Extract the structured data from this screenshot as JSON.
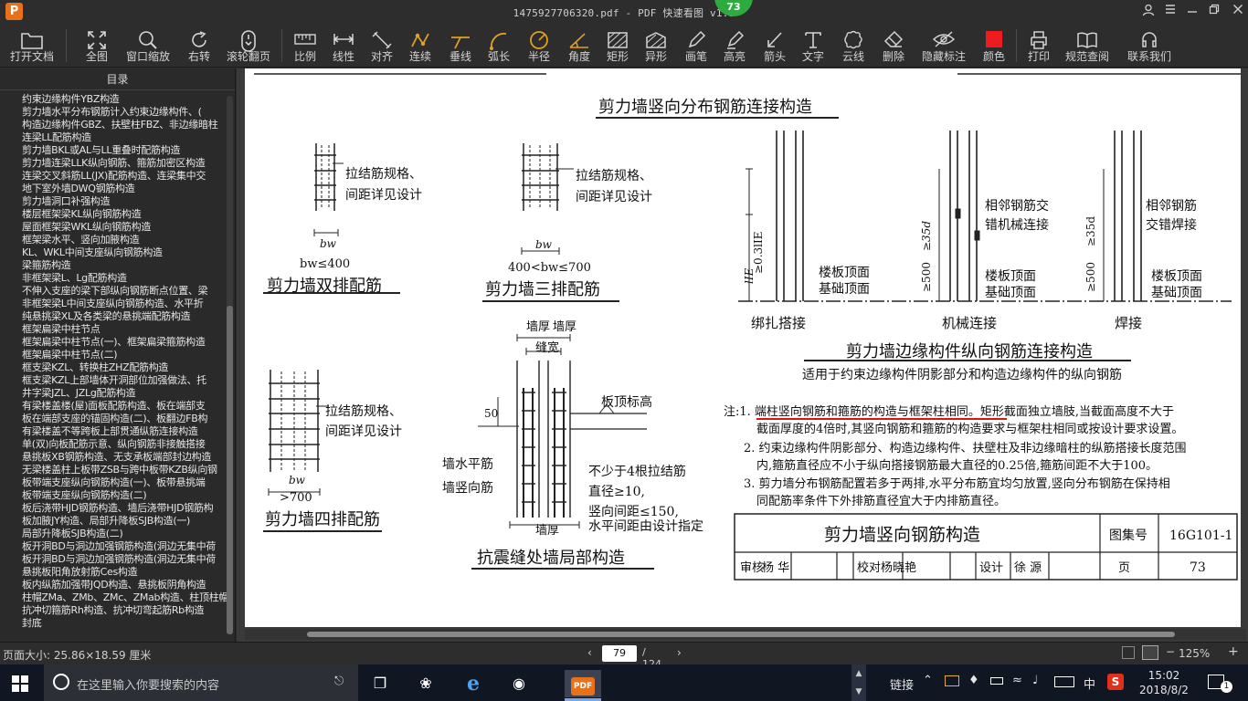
{
  "window": {
    "title": "1475927706320.pdf - PDF 快速看图 v1.9",
    "logo_text": "P",
    "page_badge": "73"
  },
  "toolbar": {
    "items": [
      {
        "label": "打开文档",
        "icon": "folder-icon"
      },
      {
        "label": "全图",
        "icon": "fit-all-icon"
      },
      {
        "label": "窗口缩放",
        "icon": "zoom-window-icon"
      },
      {
        "label": "右转",
        "icon": "rotate-right-icon"
      },
      {
        "label": "滚轮翻页",
        "icon": "mouse-wheel-icon"
      },
      {
        "label": "比例",
        "icon": "ruler-icon"
      },
      {
        "label": "线性",
        "icon": "linear-measure-icon"
      },
      {
        "label": "对齐",
        "icon": "aligned-measure-icon"
      },
      {
        "label": "连续",
        "icon": "continuous-measure-icon"
      },
      {
        "label": "垂线",
        "icon": "perpendicular-icon"
      },
      {
        "label": "弧长",
        "icon": "arc-length-icon"
      },
      {
        "label": "半径",
        "icon": "radius-icon"
      },
      {
        "label": "角度",
        "icon": "angle-icon"
      },
      {
        "label": "矩形",
        "icon": "rectangle-area-icon"
      },
      {
        "label": "异形",
        "icon": "polygon-area-icon"
      },
      {
        "label": "画笔",
        "icon": "pen-icon"
      },
      {
        "label": "高亮",
        "icon": "highlighter-icon"
      },
      {
        "label": "箭头",
        "icon": "arrow-icon"
      },
      {
        "label": "文字",
        "icon": "text-icon"
      },
      {
        "label": "云线",
        "icon": "cloud-line-icon"
      },
      {
        "label": "删除",
        "icon": "eraser-icon"
      },
      {
        "label": "隐藏标注",
        "icon": "hide-annotation-icon"
      },
      {
        "label": "颜色",
        "icon": "color-swatch-icon"
      },
      {
        "label": "打印",
        "icon": "printer-icon"
      },
      {
        "label": "规范查阅",
        "icon": "book-icon"
      },
      {
        "label": "联系我们",
        "icon": "headset-icon"
      }
    ]
  },
  "sidebar": {
    "header": "目录",
    "items": [
      "约束边缘构件YBZ构造",
      "剪力墙水平分布钢筋计入约束边缘构件、(",
      "构造边缘构件GBZ、扶壁柱FBZ、非边缘暗柱",
      "连梁LL配筋构造",
      "剪力墙BKL或AL与LL重叠时配筋构造",
      "剪力墙连梁LLK纵向钢筋、箍筋加密区构造",
      "连梁交叉斜筋LL(JX)配筋构造、连梁集中交",
      "地下室外墙DWQ钢筋构造",
      "剪力墙洞口补强构造",
      "楼层框架梁KL纵向钢筋构造",
      "屋面框架梁WKL纵向钢筋构造",
      "框架梁水平、竖向加腋构造",
      "KL、WKL中间支座纵向钢筋构造",
      "梁箍筋构造",
      "非框架梁L、Lg配筋构造",
      "不伸入支座的梁下部纵向钢筋断点位置、梁",
      "非框架梁L中间支座纵向钢筋构造、水平折",
      "纯悬挑梁XL及各类梁的悬挑端配筋构造",
      "框架扁梁中柱节点",
      "框架扁梁中柱节点(一)、框架扁梁箍筋构造",
      "框架扁梁中柱节点(二)",
      "框支梁KZL、转换柱ZHZ配筋构造",
      "框支梁KZL上部墙体开洞部位加强做法、托",
      "井字梁JZL、JZLg配筋构造",
      "有梁楼盖楼(屋)面板配筋构造、板在端部支",
      "板在端部支座的锚固构造(二)、板翻边FB构",
      "有梁楼盖不等跨板上部贯通纵筋连接构造",
      "单(双)向板配筋示意、纵向钢筋非接触搭接",
      "悬挑板XB钢筋构造、无支承板端部封边构造",
      "无梁楼盖柱上板带ZSB与跨中板带KZB纵向钢",
      "板带端支座纵向钢筋构造(一)、板带悬挑端",
      "板带端支座纵向钢筋构造(二)",
      "板后浇带HJD钢筋构造、墙后浇带HJD钢筋构",
      "板加腋JY构造、局部升降板SJB构造(一)",
      "局部升降板SJB构造(二)",
      "板开洞BD与洞边加强钢筋构造(洞边无集中荷",
      "板开洞BD与洞边加强钢筋构造(洞边无集中荷",
      "悬挑板阳角放射筋Ces构造",
      "板内纵筋加强带JQD构造、悬挑板阴角构造",
      "柱帽ZMa、ZMb、ZMc、ZMab构造、柱顶柱帽",
      "抗冲切箍筋Rh构造、抗冲切弯起筋Rb构造",
      "封底"
    ]
  },
  "document": {
    "section_title": "剪力墙竖向分布钢筋连接构造",
    "tie_note_1": "拉结筋规格、",
    "tie_note_2": "间距详见设计",
    "double_title": "剪力墙双排配筋",
    "double_dim": "bw≤400",
    "triple_title": "剪力墙三排配筋",
    "triple_dim": "400<bw≤700",
    "quad_title": "剪力墙四排配筋",
    "quad_dim": ">700",
    "bw": "bw",
    "lap_caption": "绑扎搭接",
    "mech_caption": "机械连接",
    "weld_caption": "焊接",
    "lap_length": "≥0.3lIE",
    "lap_le": "lIE",
    "adj_mech_1": "相邻钢筋交",
    "adj_mech_2": "错机械连接",
    "adj_weld_1": "相邻钢筋",
    "adj_weld_2": "交错焊接",
    "floor_1": "楼板顶面",
    "floor_2": "基础顶面",
    "dim_500": "≥500",
    "dim_35d": "≥35d",
    "edge_title": "剪力墙边缘构件纵向钢筋连接构造",
    "edge_sub": "适用于约束边缘构件阴影部分和构造边缘构件的纵向钢筋",
    "seismic_title": "抗震缝处墙局部构造",
    "wall_thk": "墙厚",
    "gap_w": "缝宽",
    "slab_top": "板顶标高",
    "h_bar": "墙水平筋",
    "v_bar": "墙竖向筋",
    "dim_50": "50",
    "min_ties_1": "不少于4根拉结筋",
    "min_ties_2": "直径≥10,",
    "min_ties_3": "竖向间距≤150,",
    "min_ties_4": "水平间距由设计指定",
    "notes": [
      "注:1. 端柱竖向钢筋和箍筋的构造与框架柱相同。矩形截面独立墙肢,当截面高度不大于",
      "截面厚度的4倍时,其竖向钢筋和箍筋的构造要求与框架柱相同或按设计要求设置。",
      "2. 约束边缘构件阴影部分、构造边缘构件、扶壁柱及非边缘暗柱的纵筋搭接长度范围",
      "内,箍筋直径应不小于纵向搭接钢筋最大直径的0.25倍,箍筋间距不大于100。",
      "3. 剪力墙分布钢筋配置若多于两排,水平分布筋宜均匀放置,竖向分布钢筋在保持相",
      "同配筋率条件下外排筋直径宜大于内排筋直径。"
    ],
    "title_block": {
      "name": "剪力墙竖向钢筋构造",
      "atlas_label": "图集号",
      "atlas_no": "16G101-1",
      "review": "审核",
      "reviewer": "杨 华",
      "check": "校对",
      "checker": "杨晓艳",
      "design": "设计",
      "designer": "徐 源",
      "page_label": "页",
      "page_no": "73"
    }
  },
  "status": {
    "page_size": "页面大小: 25.86×18.59 厘米",
    "current_page": "79",
    "total_pages": "/ 124",
    "zoom": "125%"
  },
  "taskbar": {
    "search_placeholder": "在这里输入你要搜索的内容",
    "link_label": "链接",
    "ime": "中",
    "time": "15:02",
    "date": "2018/8/2",
    "notifications": "1"
  }
}
